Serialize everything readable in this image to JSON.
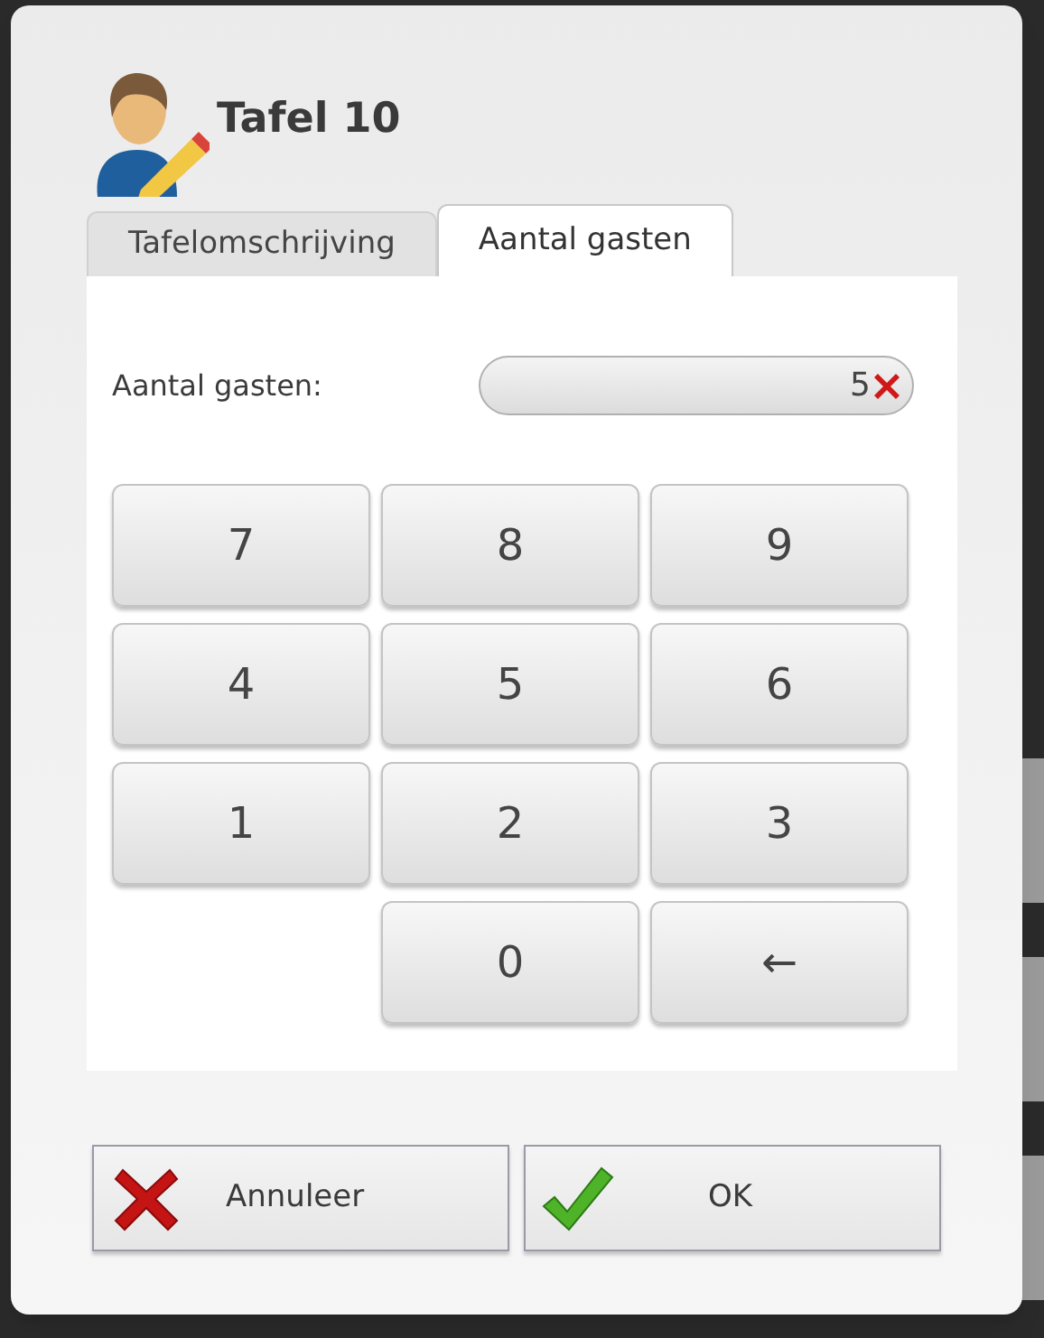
{
  "dialog": {
    "title": "Tafel 10"
  },
  "tabs": [
    {
      "label": "Tafelomschrijving",
      "selected": false
    },
    {
      "label": "Aantal gasten",
      "selected": true
    }
  ],
  "guests_field": {
    "label": "Aantal gasten:",
    "value": "5"
  },
  "keypad": [
    {
      "kind": "digit",
      "label": "7"
    },
    {
      "kind": "digit",
      "label": "8"
    },
    {
      "kind": "digit",
      "label": "9"
    },
    {
      "kind": "digit",
      "label": "4"
    },
    {
      "kind": "digit",
      "label": "5"
    },
    {
      "kind": "digit",
      "label": "6"
    },
    {
      "kind": "digit",
      "label": "1"
    },
    {
      "kind": "digit",
      "label": "2"
    },
    {
      "kind": "digit",
      "label": "3"
    },
    {
      "kind": "empty"
    },
    {
      "kind": "digit",
      "label": "0"
    },
    {
      "kind": "backspace",
      "label": "←"
    }
  ],
  "buttons": [
    {
      "kind": "cancel",
      "label": "Annuleer"
    },
    {
      "kind": "ok",
      "label": "OK"
    }
  ]
}
